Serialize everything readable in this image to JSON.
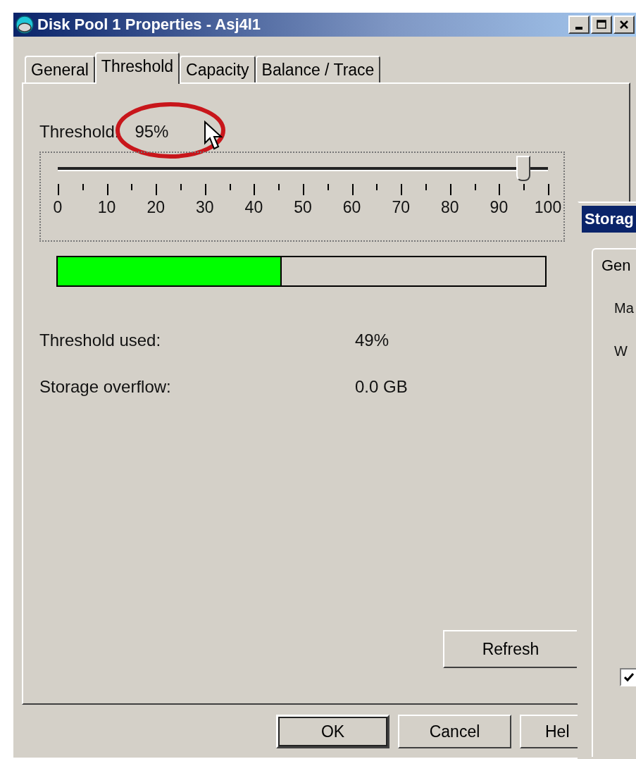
{
  "window": {
    "title": "Disk Pool 1 Properties - Asj4l1"
  },
  "tabs": [
    {
      "label": "General",
      "selected": false
    },
    {
      "label": "Threshold",
      "selected": true
    },
    {
      "label": "Capacity",
      "selected": false
    },
    {
      "label": "Balance / Trace",
      "selected": false
    }
  ],
  "threshold": {
    "label": "Threshold:",
    "value": "95%",
    "level": 0.95,
    "scale": [
      "0",
      "10",
      "20",
      "30",
      "40",
      "50",
      "60",
      "70",
      "80",
      "90",
      "100"
    ]
  },
  "usage_bar": {
    "level": 0.46
  },
  "stats": [
    {
      "label": "Threshold used:",
      "value": "49%"
    },
    {
      "label": "Storage overflow:",
      "value": "0.0 GB"
    }
  ],
  "refresh_button": "Refresh",
  "buttons": [
    {
      "label": "OK",
      "default": true
    },
    {
      "label": "Cancel",
      "default": false
    },
    {
      "label": "Hel",
      "default": false
    }
  ],
  "background_window": {
    "title": "Storag",
    "tab": "Gen",
    "labels": [
      "Ma",
      "W"
    ],
    "checkbox": {
      "checked": true
    }
  }
}
